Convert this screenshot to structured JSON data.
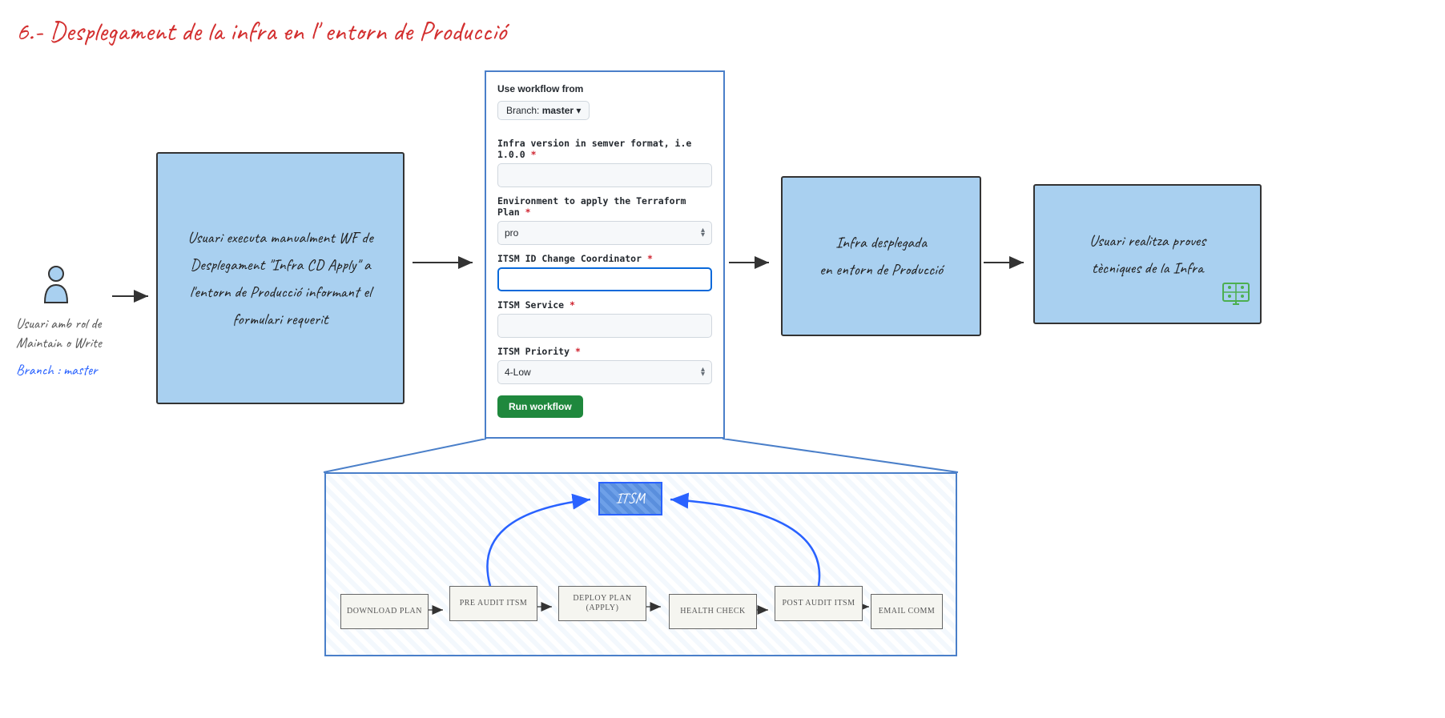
{
  "title": "6.- Desplegament de la infra en l' entorn de Producció",
  "user": {
    "label_line1": "Usuari amb rol de",
    "label_line2": "Maintain o Write",
    "branch": "Branch : master"
  },
  "box1": "Usuari executa manualment WF de Desplegament \"Infra CD Apply\" a l'entorn de Producció informant el formulari requerit",
  "box3_line1": "Infra desplegada",
  "box3_line2": "en entorn de Producció",
  "box4_line1": "Usuari realitza proves",
  "box4_line2": "tècniques de la Infra",
  "form": {
    "use_workflow": "Use workflow from",
    "branch_label": "Branch:",
    "branch_value": "master",
    "infra_version_label": "Infra version in semver format, i.e 1.0.0",
    "env_label": "Environment to apply the Terraform Plan",
    "env_value": "pro",
    "itsm_id_label": "ITSM ID Change Coordinator",
    "itsm_service_label": "ITSM Service",
    "itsm_priority_label": "ITSM Priority",
    "itsm_priority_value": "4-Low",
    "run_btn": "Run workflow"
  },
  "pipeline": {
    "itsm": "ITSM",
    "steps": [
      "DOWNLOAD PLAN",
      "PRE AUDIT ITSM",
      "DEPLOY PLAN (APPLY)",
      "HEALTH CHECK",
      "POST AUDIT ITSM",
      "EMAIL COMM"
    ]
  }
}
